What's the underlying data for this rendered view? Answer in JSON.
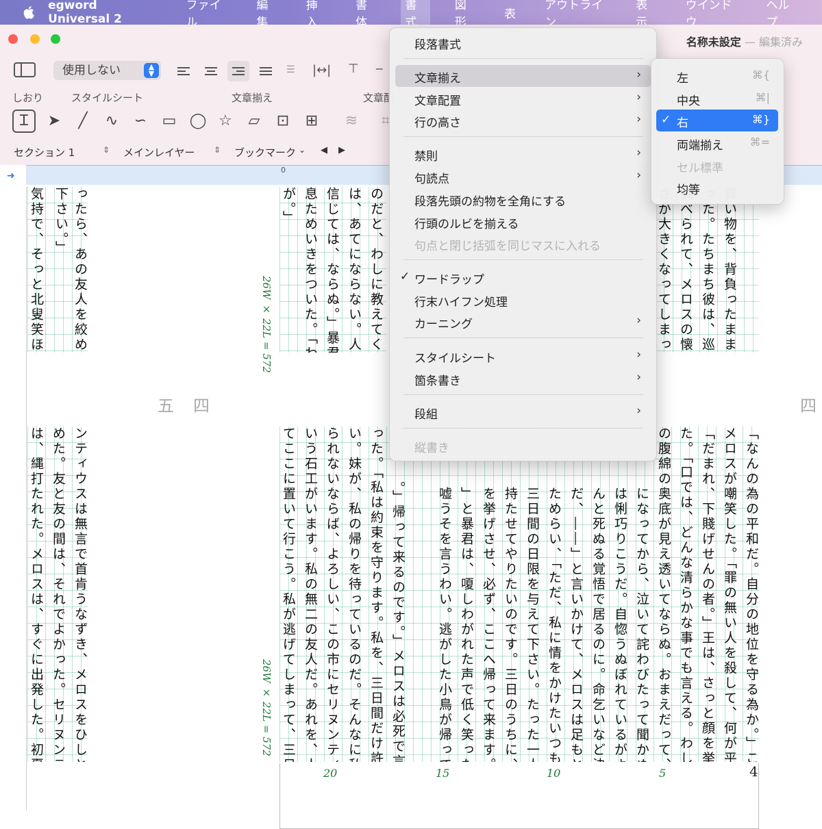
{
  "menubar": {
    "app_name": "egword Universal 2",
    "items": [
      "ファイル",
      "編集",
      "挿入",
      "書体",
      "書式",
      "図形",
      "表",
      "アウトライン",
      "表示",
      "ウインドウ",
      "ヘルプ"
    ]
  },
  "window": {
    "doc_name": "名称未設定",
    "doc_state": "編集済み",
    "style_select_value": "使用しない",
    "labels": {
      "bookmark": "しおり",
      "stylesheet": "スタイルシート",
      "align": "文章揃え",
      "align2": "文章配"
    },
    "section": {
      "section": "セクション 1",
      "layer": "メインレイヤー",
      "bookmark": "ブックマーク"
    },
    "ruler_zero": "0"
  },
  "format_menu": {
    "items": [
      {
        "label": "段落書式"
      },
      {
        "label": "文章揃え"
      },
      {
        "label": "文章配置"
      },
      {
        "label": "行の高さ"
      },
      {
        "label": "禁則"
      },
      {
        "label": "句読点"
      },
      {
        "label": "段落先頭の約物を全角にする"
      },
      {
        "label": "行頭のルビを揃える"
      },
      {
        "label": "句点と閉じ括弧を同じマスに入れる"
      },
      {
        "label": "ワードラップ"
      },
      {
        "label": "行末ハイフン処理"
      },
      {
        "label": "カーニング"
      },
      {
        "label": "スタイルシート"
      },
      {
        "label": "箇条書き"
      },
      {
        "label": "段組"
      },
      {
        "label": "縦書き"
      }
    ],
    "check": "✓"
  },
  "align_submenu": {
    "items": [
      {
        "label": "左",
        "shortcut": "⌘{"
      },
      {
        "label": "中央",
        "shortcut": "⌘|"
      },
      {
        "label": "右",
        "shortcut": "⌘}"
      },
      {
        "label": "両端揃え",
        "shortcut": "⌘="
      },
      {
        "label": "セル標準",
        "shortcut": ""
      },
      {
        "label": "均等",
        "shortcut": ""
      }
    ]
  },
  "document": {
    "grid_label": "26W × 22L = 572",
    "kanji_nums": [
      "五",
      "四",
      "四"
    ],
    "line_numbers": [
      "20",
      "15",
      "10",
      "5"
    ],
    "page_number": "4",
    "columns_top_left": [
      "ったら、あの友人を絞め殺し",
      "下さい。」",
      "気持で、そっと北叟笑ほくそ"
    ],
    "columns_top_mid": [
      "のだと、わしに教えてくれた",
      "は、あてにならない。人間は、",
      "信じては、ならぬ。」暴君は落",
      "息ためいきをついた。「わしだ",
      "が。」"
    ],
    "columns_top_right": [
      "買い物を、背負ったまま",
      "った。たちまち彼は、巡邏",
      "調べられて、メロスの懐中",
      "さが大きくなってしまった。"
    ],
    "columns_bottom_left": [
      "ンティウスは無言で首肯うなずき、メロスをひしと抱きし",
      "めた。友と友の間は、それでよかった。セリヌンティウス",
      "は、縄打たれた。メロスは、すぐに出発した。初夏、満天"
    ],
    "columns_bottom_mid": [
      "てここに置いて行こう。私が逃げてしまって、三日目の日",
      "いう石工がいます。私の無二の友人だ。あれを、人質とし",
      "られないならば、よろしい、この市にセリヌンティウスと",
      "い。妹が、私の帰りを待っているのだ。そんなに私を信じ",
      "った。「私は約束を守ります。私を、三日間だけ許して下さ",
      "。」帰って来るのです。」メロスは必死で言い張"
    ],
    "columns_bottom_right": [
      "「なんの為の平和だ。自分の地位を守る為か。」こんどは",
      "メロスが嘲笑した。「罪の無い人を殺して、何が平和だ。」",
      "「だまれ、下賤げせんの者。」王は、さっと顔を挙げて報い",
      "た。「口では、どんな清らかな事でも言える。わしには、人",
      "の腹綿の奥底が見え透いてならぬ。おまえだって、いまに、",
      "になってから、泣いて詫わびたって聞かぬぞ。」",
      "は悧巧りこうだ。自惚うぬぼれているがよい。",
      "んと死ぬる覚悟で居るのに。命乞いなど決して",
      "だ、――」と言いかけて、メロスは足もとに視線",
      "ためらい、「ただ、私に情をかけたいつもりなら、",
      "三日間の日限を与えて下さい。たった一人の妹",
      "持たせてやりたいのです。三日のうちに、私は",
      "を挙げさせ、必ず、ここへ帰って来ます。」",
      "」と暴君は、嗄しわがれた声で低く笑った。「と",
      "嘘うそを言うわい。逃がした小鳥が帰って来る"
    ]
  }
}
